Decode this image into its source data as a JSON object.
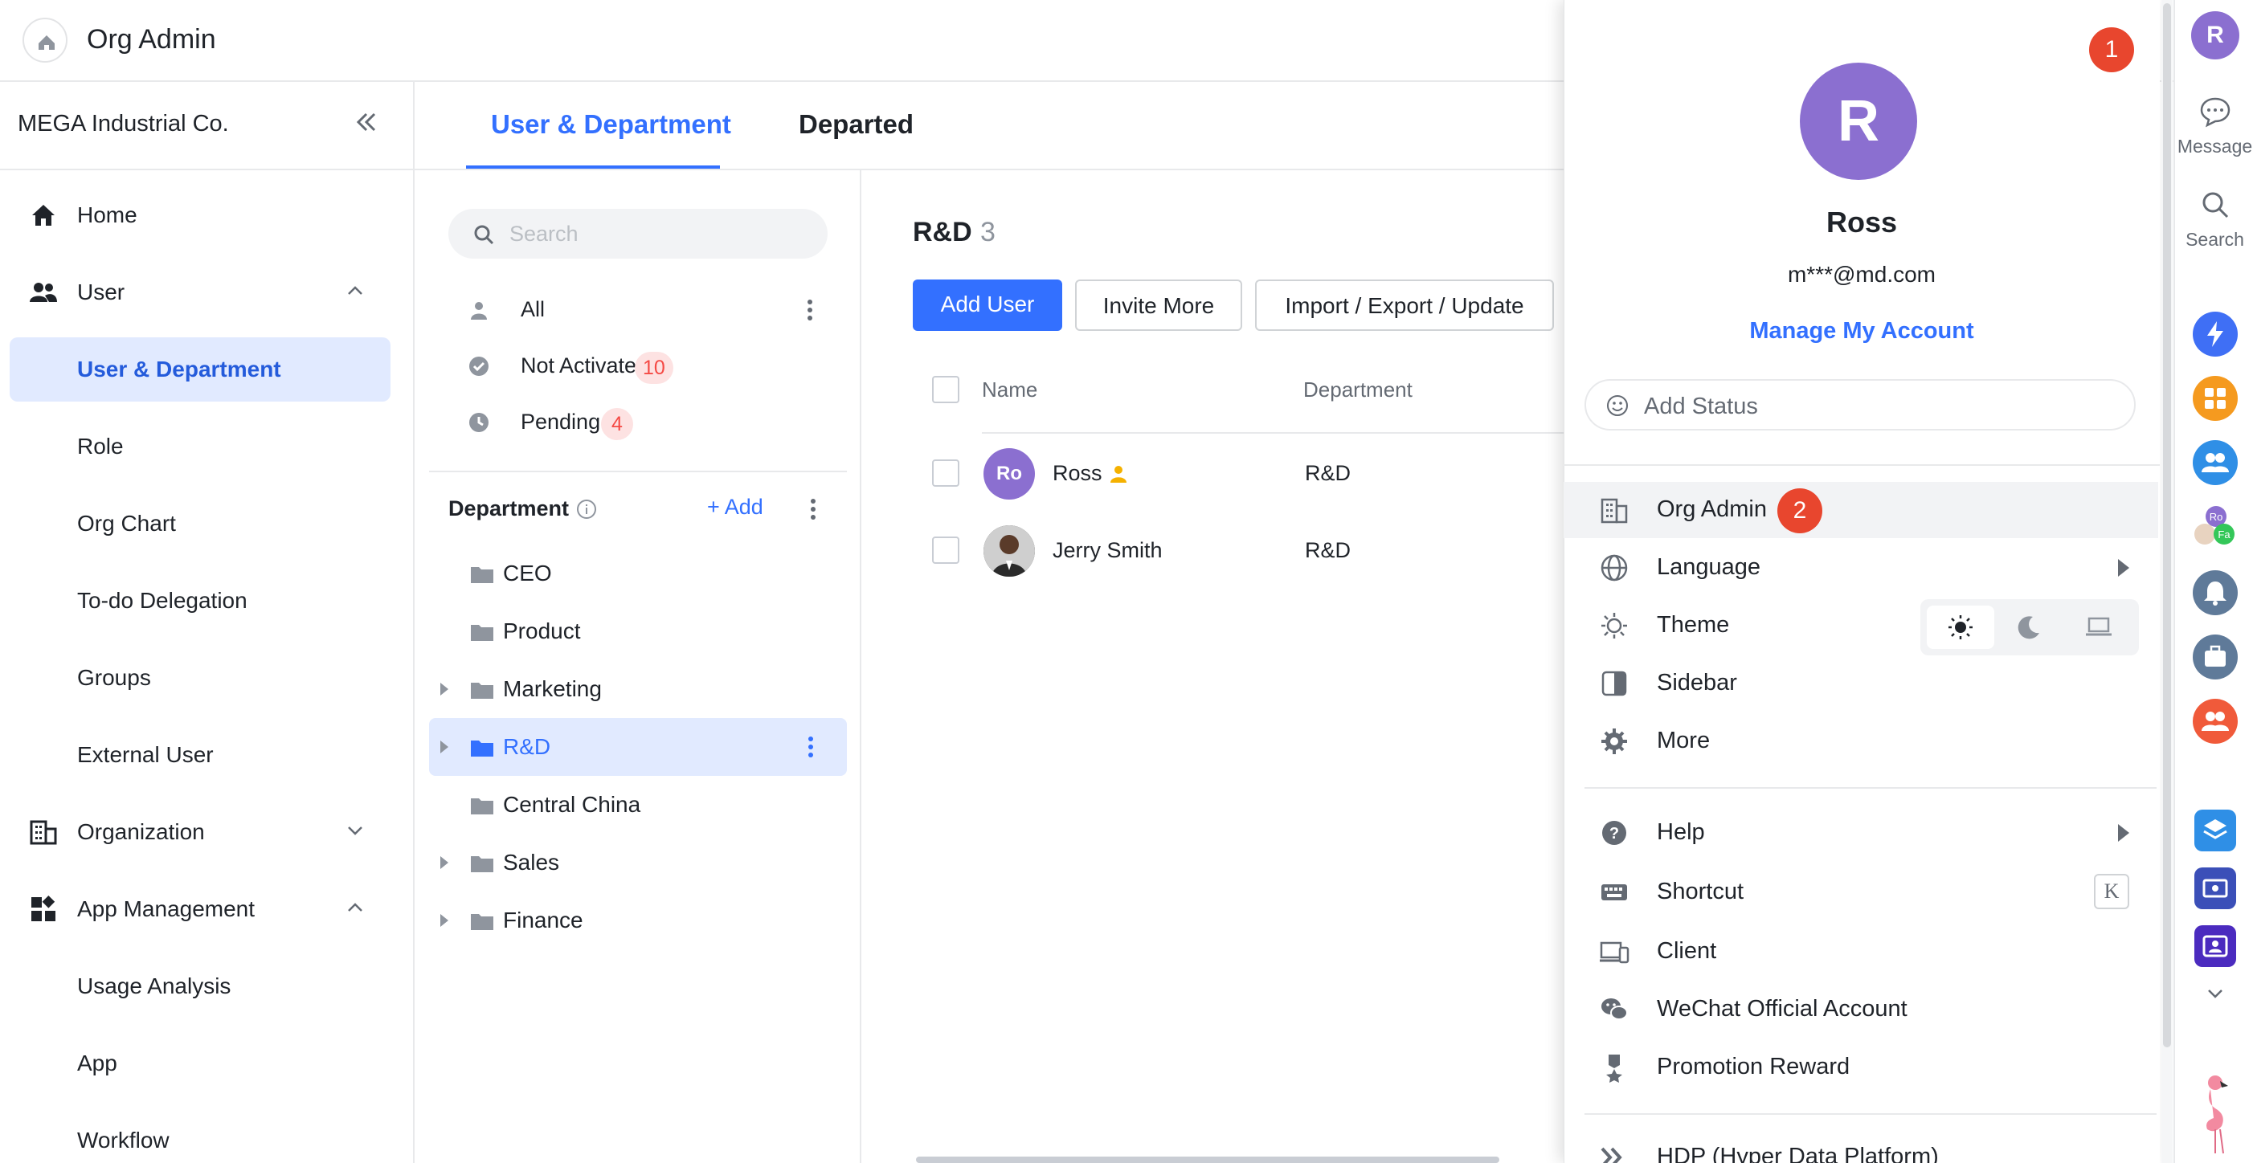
{
  "header": {
    "title": "Org Admin"
  },
  "sidebar": {
    "org_name": "MEGA Industrial Co.",
    "items": [
      {
        "label": "Home"
      },
      {
        "label": "User"
      },
      {
        "label": "User & Department"
      },
      {
        "label": "Role"
      },
      {
        "label": "Org Chart"
      },
      {
        "label": "To-do Delegation"
      },
      {
        "label": "Groups"
      },
      {
        "label": "External User"
      },
      {
        "label": "Organization"
      },
      {
        "label": "App Management"
      },
      {
        "label": "Usage Analysis"
      },
      {
        "label": "App"
      },
      {
        "label": "Workflow"
      }
    ]
  },
  "tabs": [
    {
      "label": "User & Department"
    },
    {
      "label": "Departed"
    }
  ],
  "dept_panel": {
    "search_placeholder": "Search",
    "filters": [
      {
        "label": "All"
      },
      {
        "label": "Not Activated",
        "count": "10"
      },
      {
        "label": "Pending",
        "count": "4"
      }
    ],
    "department_heading": "Department",
    "add_label": "+ Add",
    "departments": [
      {
        "label": "CEO"
      },
      {
        "label": "Product"
      },
      {
        "label": "Marketing"
      },
      {
        "label": "R&D"
      },
      {
        "label": "Central China"
      },
      {
        "label": "Sales"
      },
      {
        "label": "Finance"
      }
    ]
  },
  "main": {
    "title": "R&D",
    "count": "3",
    "buttons": {
      "add_user": "Add User",
      "invite_more": "Invite More",
      "import_export": "Import / Export / Update"
    },
    "columns": {
      "name": "Name",
      "department": "Department"
    },
    "rows": [
      {
        "avatar_initials": "Ro",
        "name": "Ross",
        "department": "R&D"
      },
      {
        "name": "Jerry Smith",
        "department": "R&D"
      }
    ]
  },
  "profile": {
    "marker_1": "1",
    "avatar_letter": "R",
    "name": "Ross",
    "email": "m***@md.com",
    "manage_link": "Manage My Account",
    "status_placeholder": "Add Status",
    "marker_2": "2",
    "menu": [
      {
        "label": "Org Admin"
      },
      {
        "label": "Language"
      },
      {
        "label": "Theme"
      },
      {
        "label": "Sidebar"
      },
      {
        "label": "More"
      },
      {
        "label": "Help"
      },
      {
        "label": "Shortcut",
        "key": "K"
      },
      {
        "label": "Client"
      },
      {
        "label": "WeChat Official Account"
      },
      {
        "label": "Promotion Reward"
      },
      {
        "label": "HDP (Hyper Data Platform)"
      }
    ]
  },
  "rail": {
    "avatar_letter": "R",
    "message_label": "Message",
    "search_label": "Search",
    "mini_avatar_1": "Ro",
    "mini_avatar_2": "Fa"
  },
  "colors": {
    "accent": "#3370ff",
    "active_bg": "#e1eaff",
    "badge_red": "#f54a45",
    "marker_red": "#e8462e",
    "avatar_purple": "#8b6fd0"
  }
}
